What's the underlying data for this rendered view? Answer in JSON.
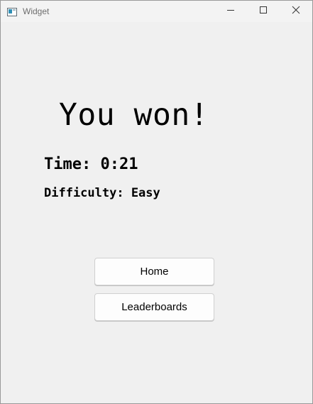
{
  "window": {
    "title": "Widget",
    "icon": "app-window-icon",
    "controls": {
      "minimize_icon": "minimize-icon",
      "maximize_icon": "maximize-icon",
      "close_icon": "close-icon"
    }
  },
  "result": {
    "heading": "You won!",
    "time": "Time: 0:21",
    "difficulty": "Difficulty: Easy"
  },
  "buttons": {
    "home_label": "Home",
    "leaderboards_label": "Leaderboards"
  },
  "colors": {
    "background": "#f0f0f0",
    "button_face": "#fdfdfd",
    "text": "#000000"
  }
}
